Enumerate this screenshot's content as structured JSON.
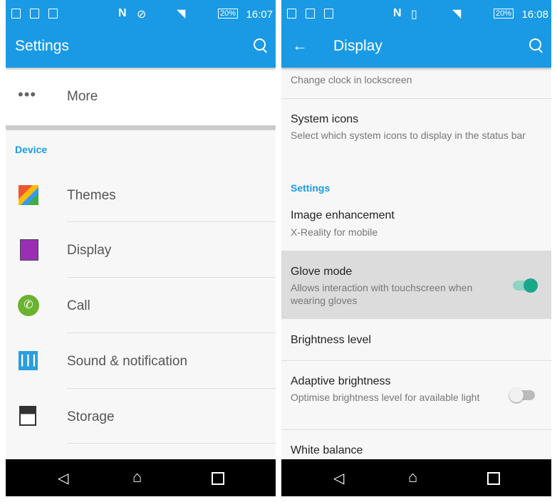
{
  "left": {
    "time": "16:07",
    "battery": "20%",
    "title": "Settings",
    "more": "More",
    "section": "Device",
    "items": [
      {
        "label": "Themes",
        "icon": "themes-icon"
      },
      {
        "label": "Display",
        "icon": "display-icon"
      },
      {
        "label": "Call",
        "icon": "call-icon"
      },
      {
        "label": "Sound & notification",
        "icon": "sound-icon"
      },
      {
        "label": "Storage",
        "icon": "storage-icon"
      }
    ]
  },
  "right": {
    "time": "16:08",
    "battery": "20%",
    "title": "Display",
    "clocks_sub": "Change clock in lockscreen",
    "system_icons": {
      "title": "System icons",
      "sub": "Select which system icons to display in the status bar"
    },
    "section": "Settings",
    "image_enh": {
      "title": "Image enhancement",
      "sub": "X-Reality for mobile"
    },
    "glove": {
      "title": "Glove mode",
      "sub": "Allows interaction with touchscreen when wearing gloves",
      "on": true
    },
    "brightness": {
      "title": "Brightness level"
    },
    "adaptive": {
      "title": "Adaptive brightness",
      "sub": "Optimise brightness level for available light",
      "on": false
    },
    "white_balance": {
      "title": "White balance"
    }
  },
  "colors": {
    "accent": "#1a9ae4",
    "toggle_on": "#1aa88a"
  }
}
